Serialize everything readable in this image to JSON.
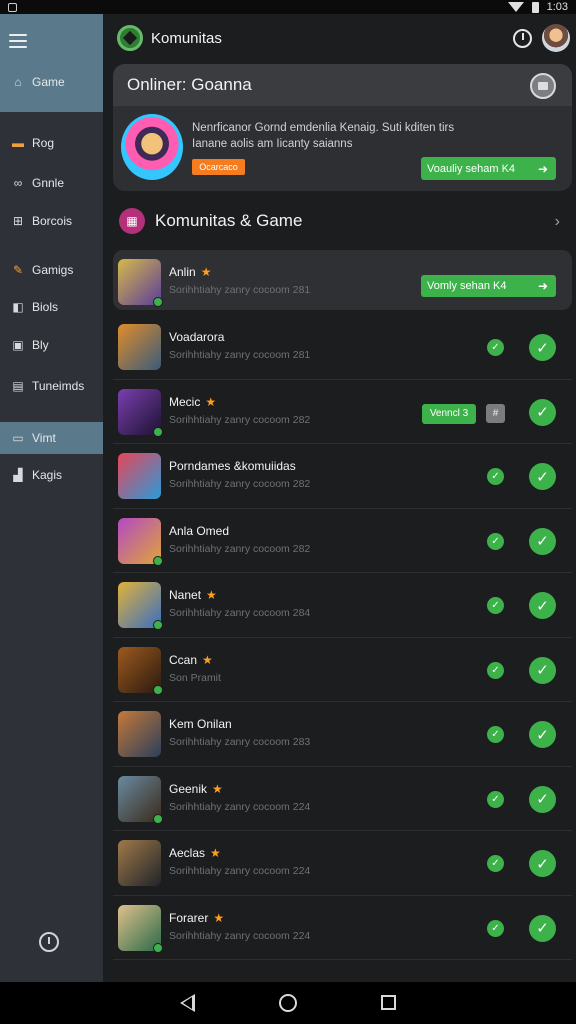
{
  "status_bar": {
    "time": "1:03"
  },
  "header": {
    "title": "Komunitas"
  },
  "sidebar": {
    "items": [
      {
        "label": "Game",
        "icon": "home-icon"
      },
      {
        "label": "Rog",
        "icon": "folder-icon"
      },
      {
        "label": "Gnnle",
        "icon": "link-icon"
      },
      {
        "label": "Borcois",
        "icon": "grid-icon"
      },
      {
        "label": "Gamigs",
        "icon": "pencil-icon"
      },
      {
        "label": "Biols",
        "icon": "book-icon"
      },
      {
        "label": "Bly",
        "icon": "square-icon"
      },
      {
        "label": "Tuneimds",
        "icon": "list-icon"
      },
      {
        "label": "Vimt",
        "icon": "gamepad-icon"
      },
      {
        "label": "Kagis",
        "icon": "stack-icon"
      }
    ]
  },
  "online_card": {
    "title": "Onliner: Goanna",
    "text": "Nenrficanor Gornd emdenlia Kenaig. Suti kditen tirs Ianane aolis am Iicanty saianns",
    "badge": "Ocarcaco",
    "button": "Voauliy seham K4"
  },
  "section": {
    "title": "Komunitas & Game"
  },
  "rows": [
    {
      "name": "Anlin",
      "star": true,
      "sub": "Sorihhtiahy zanry cocoom 281",
      "action": "Vomly sehan K4",
      "colors": [
        "#d6b94a",
        "#5b3c9a"
      ]
    },
    {
      "name": "Voadarora",
      "star": false,
      "sub": "Sorihhtiahy zanry cocoom 281",
      "colors": [
        "#e08d2a",
        "#3a5b7a"
      ]
    },
    {
      "name": "Mecic",
      "star": true,
      "sub": "Sorihhtiahy zanry cocoom 282",
      "action": "Venncl 3",
      "extra_icon": "tag-icon",
      "colors": [
        "#7a3fb0",
        "#1d1230"
      ]
    },
    {
      "name": "Porndames &komuiidas",
      "star": false,
      "sub": "Sorihhtiahy zanry cocoom 282",
      "colors": [
        "#e8455a",
        "#2a9bd8"
      ]
    },
    {
      "name": "Anla Omed",
      "star": false,
      "sub": "Sorihhtiahy zanry cocoom 282",
      "colors": [
        "#b24ac2",
        "#e0a43a"
      ]
    },
    {
      "name": "Nanet",
      "star": true,
      "sub": "Sorihhtiahy zanry cocoom 284",
      "colors": [
        "#e0b23a",
        "#3a6ec2"
      ]
    },
    {
      "name": "Ccan",
      "star": true,
      "sub": "Son Pramit",
      "colors": [
        "#9c5a1e",
        "#2a1a10"
      ]
    },
    {
      "name": "Kem Onilan",
      "star": false,
      "sub": "Sorihhtiahy zanry cocoom 283",
      "colors": [
        "#c47a3a",
        "#2b3e5a"
      ]
    },
    {
      "name": "Geenik",
      "star": true,
      "sub": "Sorihhtiahy zanry cocoom 224",
      "colors": [
        "#6a8aa0",
        "#3a2a1a"
      ]
    },
    {
      "name": "Aeclas",
      "star": true,
      "sub": "Sorihhtiahy zanry cocoom 224",
      "colors": [
        "#a07a4a",
        "#202428"
      ]
    },
    {
      "name": "Forarer",
      "star": true,
      "sub": "Sorihhtiahy zanry cocoom 224",
      "colors": [
        "#e0c08a",
        "#2a6a4a"
      ]
    }
  ]
}
